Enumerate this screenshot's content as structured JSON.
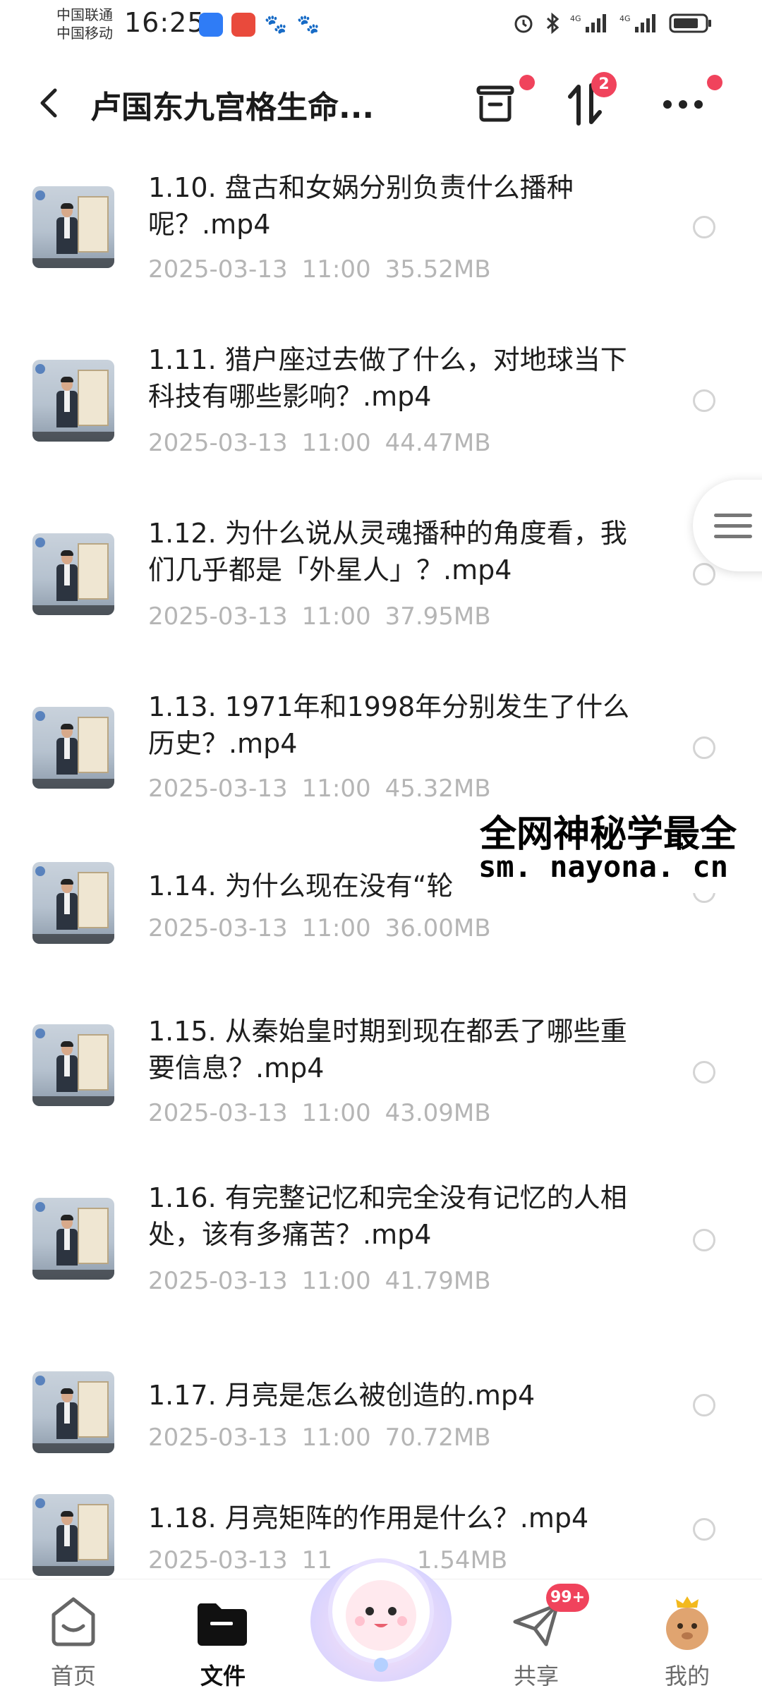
{
  "status_bar": {
    "carrier1": "中国联通",
    "carrier2": "中国移动",
    "time": "16:25"
  },
  "header": {
    "title": "卢国东九宫格生命...",
    "sort_badge": "2"
  },
  "files": [
    {
      "name": "1.10. 盘古和女娲分别负责什么播种呢？.mp4",
      "date": "2025-03-13",
      "time": "11:00",
      "size": "35.52MB"
    },
    {
      "name": "1.11. 猎户座过去做了什么，对地球当下科技有哪些影响？.mp4",
      "date": "2025-03-13",
      "time": "11:00",
      "size": "44.47MB"
    },
    {
      "name": "1.12. 为什么说从灵魂播种的角度看，我们几乎都是「外星人」？.mp4",
      "date": "2025-03-13",
      "time": "11:00",
      "size": "37.95MB"
    },
    {
      "name": "1.13. 1971年和1998年分别发生了什么历史？.mp4",
      "date": "2025-03-13",
      "time": "11:00",
      "size": "45.32MB"
    },
    {
      "name": "1.14. 为什么现在没有“轮",
      "date": "2025-03-13",
      "time": "11:00",
      "size": "36.00MB"
    },
    {
      "name": "1.15. 从秦始皇时期到现在都丢了哪些重要信息？.mp4",
      "date": "2025-03-13",
      "time": "11:00",
      "size": "43.09MB"
    },
    {
      "name": "1.16. 有完整记忆和完全没有记忆的人相处，该有多痛苦？.mp4",
      "date": "2025-03-13",
      "time": "11:00",
      "size": "41.79MB"
    },
    {
      "name": "1.17. 月亮是怎么被创造的.mp4",
      "date": "2025-03-13",
      "time": "11:00",
      "size": "70.72MB"
    },
    {
      "name": "1.18. 月亮矩阵的作用是什么？.mp4",
      "date": "2025-03-13",
      "time": "11",
      "size": "1.54MB"
    }
  ],
  "watermark": {
    "title": "全网神秘学最全",
    "url": "sm. nayona. cn"
  },
  "bottom_nav": {
    "home": "首页",
    "files": "文件",
    "share": "共享",
    "share_badge": "99+",
    "mine": "我的"
  },
  "colors": {
    "accent_red": "#f0435c",
    "meta_gray": "#b5b5b5"
  },
  "icons": {
    "back": "chevron-left-icon",
    "transfer": "inbox-icon",
    "sort": "sort-arrows-icon",
    "more": "more-dots-icon",
    "side": "menu-lines-icon"
  }
}
